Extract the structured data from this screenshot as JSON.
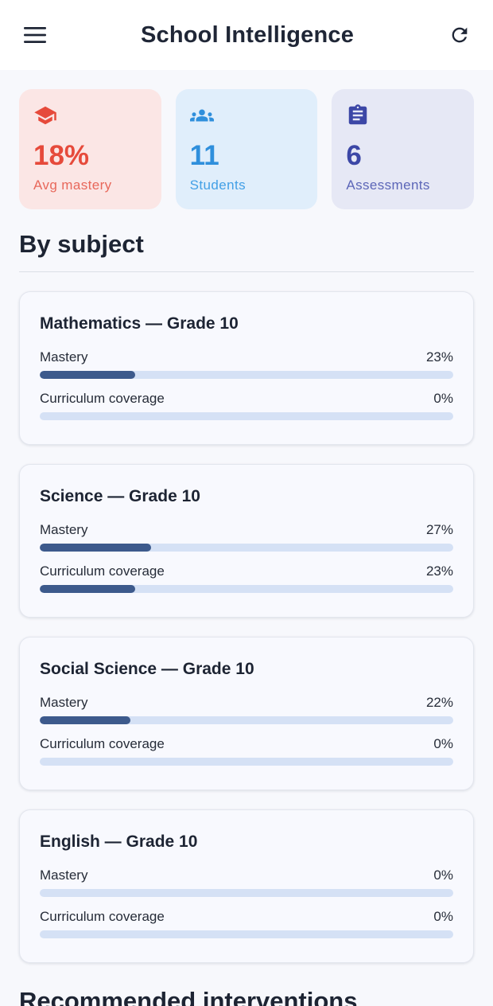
{
  "appbar": {
    "title": "School Intelligence",
    "menu_icon": "menu-icon",
    "refresh_icon": "refresh-icon"
  },
  "stats": [
    {
      "value": "18%",
      "label": "Avg mastery",
      "icon": "graduation-cap-icon",
      "color": "#e64a3b",
      "bg": "#fbe6e5",
      "label_color": "#e8685b"
    },
    {
      "value": "11",
      "label": "Students",
      "icon": "group-icon",
      "color": "#2f8fdc",
      "bg": "#e0eefb",
      "label_color": "#43a0e6"
    },
    {
      "value": "6",
      "label": "Assessments",
      "icon": "clipboard-icon",
      "color": "#3c47a6",
      "bg": "#e6e8f5",
      "label_color": "#5c66b8"
    }
  ],
  "by_subject": {
    "title": "By subject",
    "items": [
      {
        "title": "Mathematics — Grade 10",
        "mastery_label": "Mastery",
        "mastery_value": "23%",
        "mastery_pct": 23,
        "coverage_label": "Curriculum coverage",
        "coverage_value": "0%",
        "coverage_pct": 0
      },
      {
        "title": "Science — Grade 10",
        "mastery_label": "Mastery",
        "mastery_value": "27%",
        "mastery_pct": 27,
        "coverage_label": "Curriculum coverage",
        "coverage_value": "23%",
        "coverage_pct": 23
      },
      {
        "title": "Social Science — Grade 10",
        "mastery_label": "Mastery",
        "mastery_value": "22%",
        "mastery_pct": 22,
        "coverage_label": "Curriculum coverage",
        "coverage_value": "0%",
        "coverage_pct": 0
      },
      {
        "title": "English — Grade 10",
        "mastery_label": "Mastery",
        "mastery_value": "0%",
        "mastery_pct": 0,
        "coverage_label": "Curriculum coverage",
        "coverage_value": "0%",
        "coverage_pct": 0
      }
    ]
  },
  "interventions": {
    "title": "Recommended interventions"
  },
  "colors": {
    "bar_fill": "#3d5a8c",
    "bar_track": "#d5e1f5"
  }
}
